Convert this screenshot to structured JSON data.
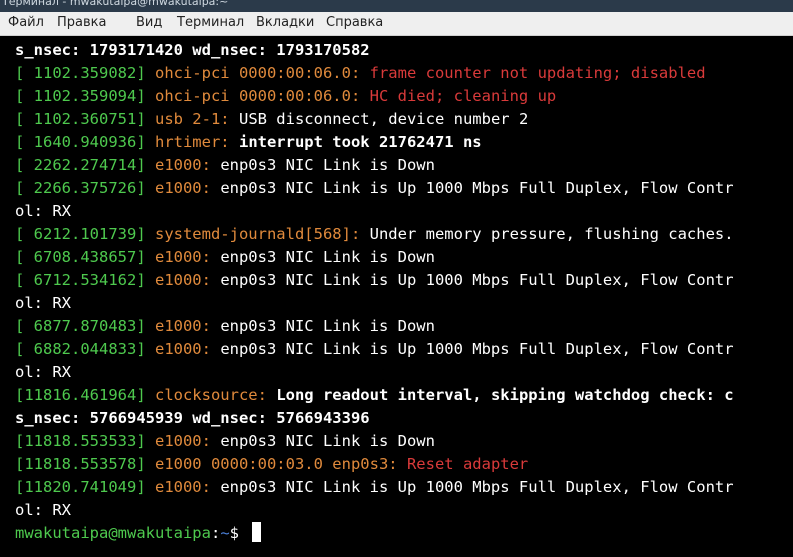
{
  "window": {
    "title": "Терминал - mwakutaipa@mwakutaipa:~"
  },
  "menu": [
    "Файл",
    "Правка",
    "Вид",
    "Терминал",
    "Вкладки",
    "Справка"
  ],
  "terminal": {
    "lines": [
      [
        {
          "t": "s_nsec: 1793171420 wd_nsec: 1793170582",
          "c": "bold"
        }
      ],
      [
        {
          "t": "[ 1102.359082] ",
          "c": "ts"
        },
        {
          "t": "ohci-pci 0000:00:06.0: ",
          "c": "src"
        },
        {
          "t": "frame counter not updating; disabled",
          "c": "err"
        }
      ],
      [
        {
          "t": "[ 1102.359094] ",
          "c": "ts"
        },
        {
          "t": "ohci-pci 0000:00:06.0: ",
          "c": "src"
        },
        {
          "t": "HC died; cleaning up",
          "c": "err"
        }
      ],
      [
        {
          "t": "[ 1102.360751] ",
          "c": "ts"
        },
        {
          "t": "usb 2-1: ",
          "c": "src"
        },
        {
          "t": "USB disconnect, device number 2",
          "c": "msg"
        }
      ],
      [
        {
          "t": "[ 1640.940936] ",
          "c": "ts"
        },
        {
          "t": "hrtimer: ",
          "c": "src"
        },
        {
          "t": "interrupt took 21762471 ns",
          "c": "bold"
        }
      ],
      [
        {
          "t": "[ 2262.274714] ",
          "c": "ts"
        },
        {
          "t": "e1000: ",
          "c": "src"
        },
        {
          "t": "enp0s3 NIC Link is Down",
          "c": "msg"
        }
      ],
      [
        {
          "t": "[ 2266.375726] ",
          "c": "ts"
        },
        {
          "t": "e1000: ",
          "c": "src"
        },
        {
          "t": "enp0s3 NIC Link is Up 1000 Mbps Full Duplex, Flow Contr",
          "c": "msg"
        }
      ],
      [
        {
          "t": "ol: RX",
          "c": "msg"
        }
      ],
      [
        {
          "t": "[ 6212.101739] ",
          "c": "ts"
        },
        {
          "t": "systemd-journald[568]: ",
          "c": "src"
        },
        {
          "t": "Under memory pressure, flushing caches.",
          "c": "msg"
        }
      ],
      [
        {
          "t": "[ 6708.438657] ",
          "c": "ts"
        },
        {
          "t": "e1000: ",
          "c": "src"
        },
        {
          "t": "enp0s3 NIC Link is Down",
          "c": "msg"
        }
      ],
      [
        {
          "t": "[ 6712.534162] ",
          "c": "ts"
        },
        {
          "t": "e1000: ",
          "c": "src"
        },
        {
          "t": "enp0s3 NIC Link is Up 1000 Mbps Full Duplex, Flow Contr",
          "c": "msg"
        }
      ],
      [
        {
          "t": "ol: RX",
          "c": "msg"
        }
      ],
      [
        {
          "t": "[ 6877.870483] ",
          "c": "ts"
        },
        {
          "t": "e1000: ",
          "c": "src"
        },
        {
          "t": "enp0s3 NIC Link is Down",
          "c": "msg"
        }
      ],
      [
        {
          "t": "[ 6882.044833] ",
          "c": "ts"
        },
        {
          "t": "e1000: ",
          "c": "src"
        },
        {
          "t": "enp0s3 NIC Link is Up 1000 Mbps Full Duplex, Flow Contr",
          "c": "msg"
        }
      ],
      [
        {
          "t": "ol: RX",
          "c": "msg"
        }
      ],
      [
        {
          "t": "[11816.461964] ",
          "c": "ts"
        },
        {
          "t": "clocksource: ",
          "c": "src"
        },
        {
          "t": "Long readout interval, skipping watchdog check: c",
          "c": "bold"
        }
      ],
      [
        {
          "t": "s_nsec: 5766945939 wd_nsec: 5766943396",
          "c": "bold"
        }
      ],
      [
        {
          "t": "[11818.553533] ",
          "c": "ts"
        },
        {
          "t": "e1000: ",
          "c": "src"
        },
        {
          "t": "enp0s3 NIC Link is Down",
          "c": "msg"
        }
      ],
      [
        {
          "t": "[11818.553578] ",
          "c": "ts"
        },
        {
          "t": "e1000 0000:00:03.0 enp0s3: ",
          "c": "src"
        },
        {
          "t": "Reset adapter",
          "c": "err"
        }
      ],
      [
        {
          "t": "[11820.741049] ",
          "c": "ts"
        },
        {
          "t": "e1000: ",
          "c": "src"
        },
        {
          "t": "enp0s3 NIC Link is Up 1000 Mbps Full Duplex, Flow Contr",
          "c": "msg"
        }
      ],
      [
        {
          "t": "ol: RX",
          "c": "msg"
        }
      ]
    ],
    "prompt": {
      "user": "mwakutaipa@mwakutaipa",
      "sep": ":",
      "path": "~",
      "symbol": "$ "
    }
  },
  "colors": {
    "timestamp": "#4ec94e",
    "source": "#e08a3c",
    "error": "#d93a3a",
    "text": "#ffffff",
    "background": "#000000"
  }
}
